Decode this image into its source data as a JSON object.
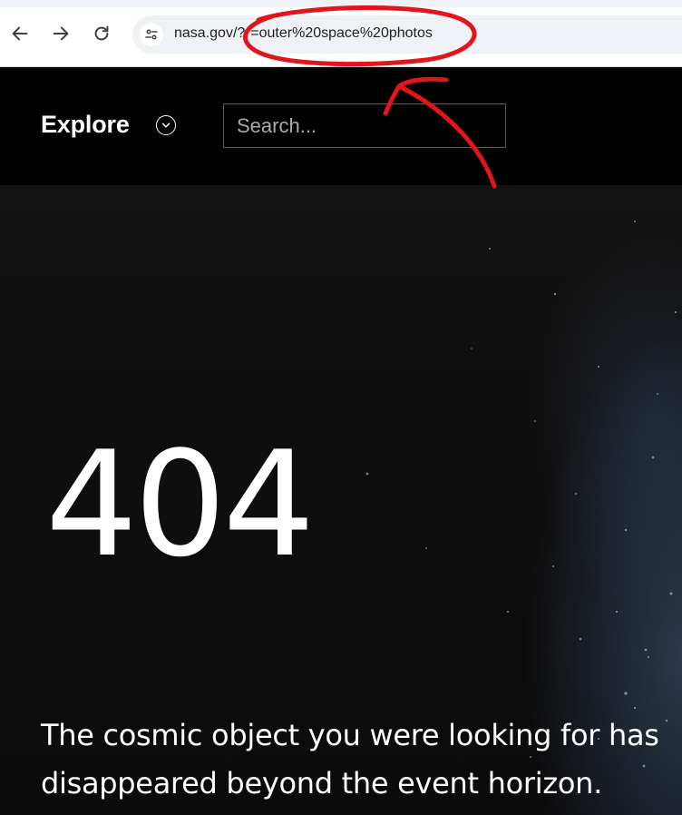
{
  "browser": {
    "url": "nasa.gov/?…=outer%20space%20photos",
    "url_host": "nasa.gov/?",
    "url_query": "=outer%20space%20photos",
    "back_icon": "arrow-left-icon",
    "forward_icon": "arrow-right-icon",
    "reload_icon": "reload-icon",
    "site_info_icon": "tune-icon"
  },
  "header": {
    "explore_label": "Explore",
    "explore_toggle_icon": "chevron-down-circle-icon",
    "search_placeholder": "Search..."
  },
  "hero": {
    "error_code": "404",
    "message": "The cosmic object you were looking for has disappeared beyond the event horizon."
  },
  "annotation": {
    "color": "#e0161b",
    "shapes": [
      "circle-around-url-query",
      "curved-arrow-pointing-up"
    ]
  },
  "colors": {
    "header_bg": "#000000",
    "text": "#ffffff",
    "annotation_red": "#e0161b"
  }
}
